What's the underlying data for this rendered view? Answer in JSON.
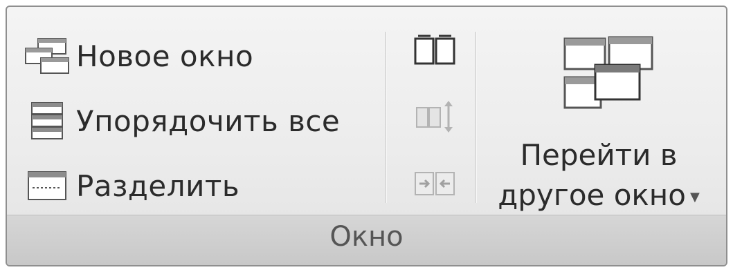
{
  "group": {
    "title": "Окно",
    "commands": {
      "new_window": "Новое окно",
      "arrange_all": "Упорядочить все",
      "split": "Разделить"
    },
    "small_buttons": [
      {
        "icon": "view-side-by-side-icon",
        "enabled": true
      },
      {
        "icon": "synchronous-scrolling-icon",
        "enabled": false
      },
      {
        "icon": "reset-window-position-icon",
        "enabled": false
      }
    ],
    "switch_windows": {
      "line1": "Перейти в",
      "line2": "другое окно",
      "has_dropdown": true
    }
  }
}
